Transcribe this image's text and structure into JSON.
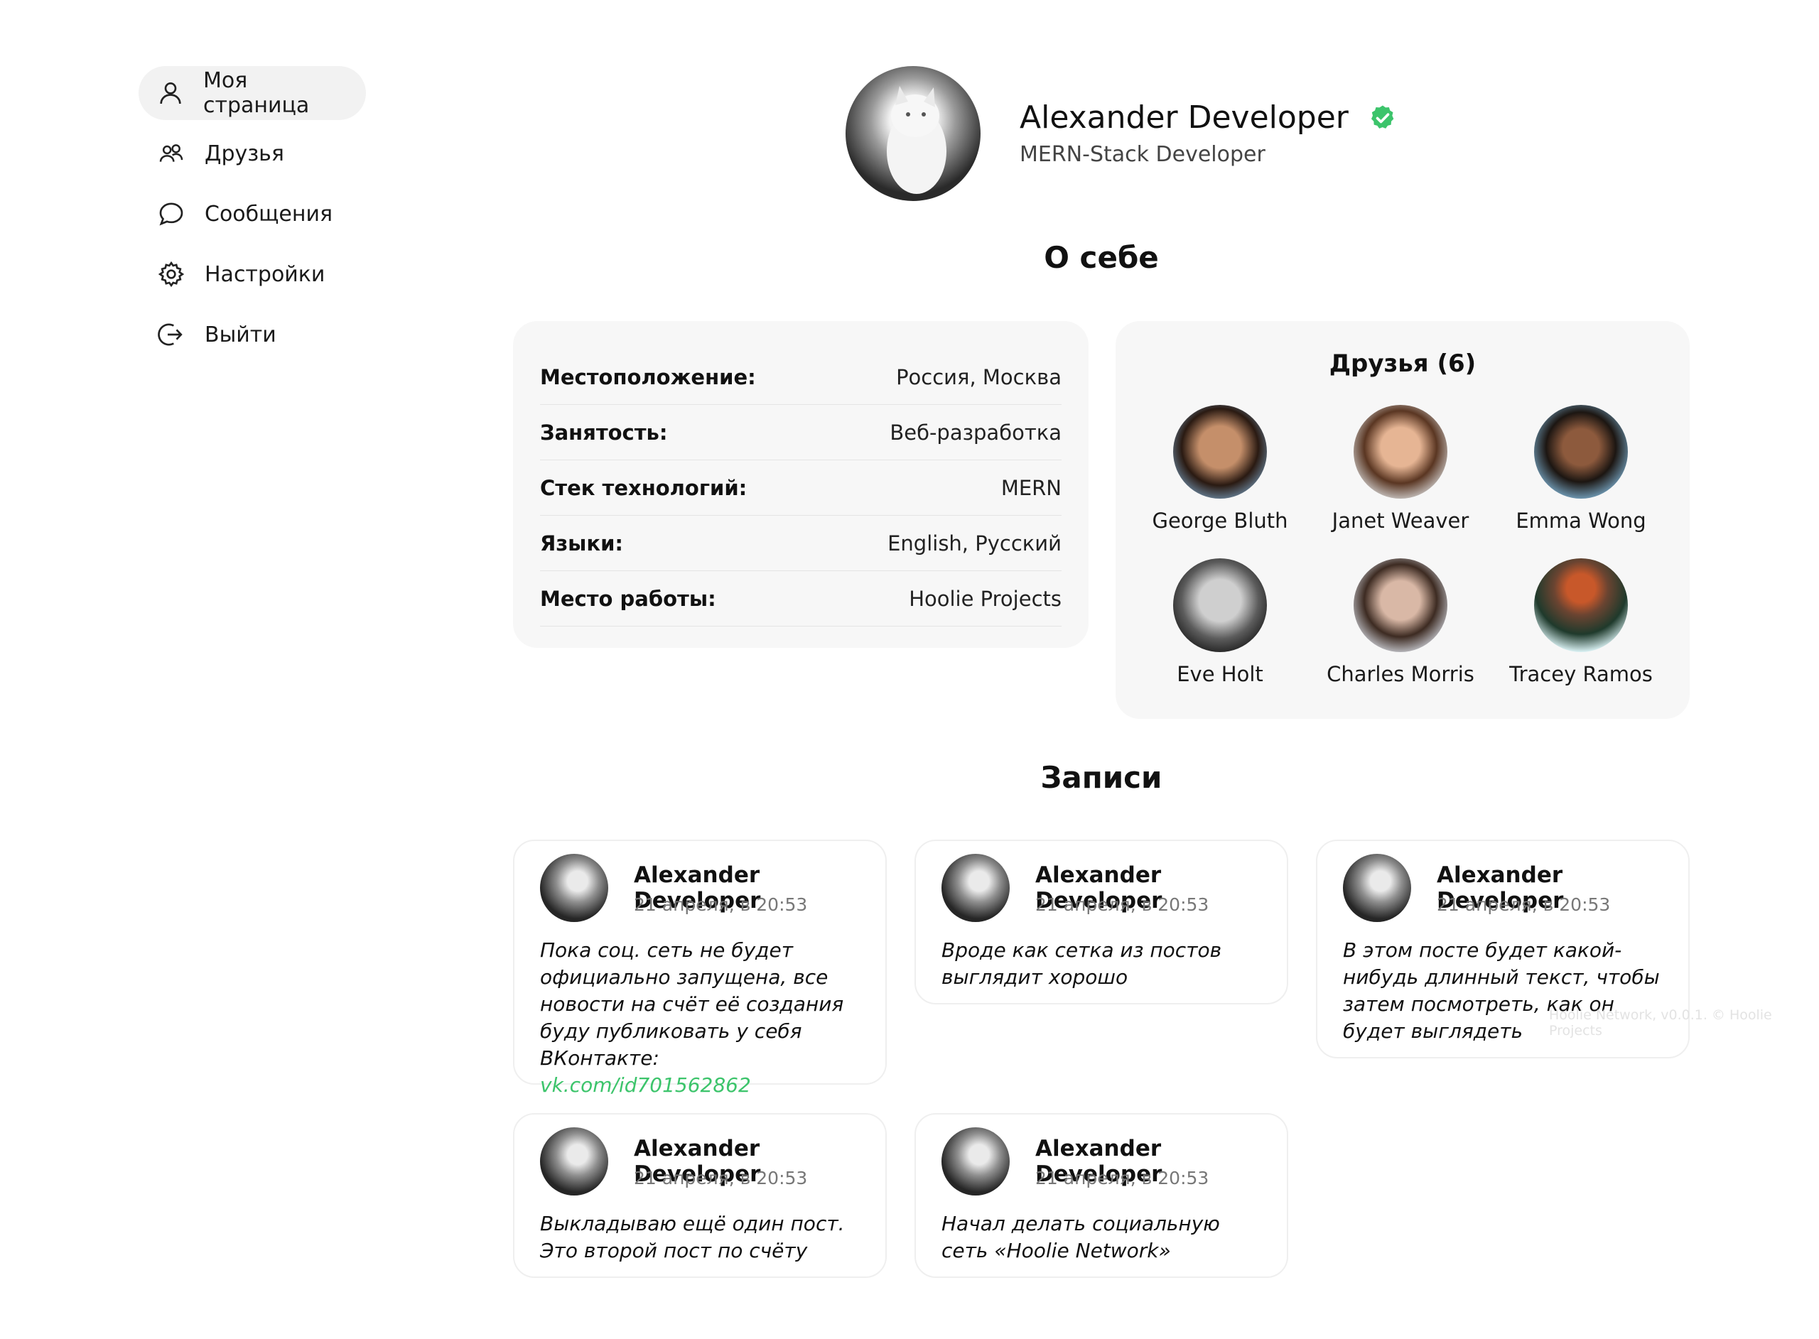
{
  "sidebar": {
    "items": [
      {
        "label": "Моя страница",
        "icon": "user-icon",
        "active": true
      },
      {
        "label": "Друзья",
        "icon": "friends-icon",
        "active": false
      },
      {
        "label": "Сообщения",
        "icon": "message-icon",
        "active": false
      },
      {
        "label": "Настройки",
        "icon": "gear-icon",
        "active": false
      },
      {
        "label": "Выйти",
        "icon": "logout-icon",
        "active": false
      }
    ]
  },
  "profile": {
    "name": "Alexander Developer",
    "role": "MERN-Stack Developer",
    "verified": true,
    "verified_color": "#3cc46b"
  },
  "about": {
    "title": "О себе",
    "rows": [
      {
        "key": "Местоположение:",
        "value": "Россия, Москва"
      },
      {
        "key": "Занятость:",
        "value": "Веб-разработка"
      },
      {
        "key": "Стек технологий:",
        "value": "MERN"
      },
      {
        "key": "Языки:",
        "value": "English, Русский"
      },
      {
        "key": "Место работы:",
        "value": "Hoolie Projects"
      }
    ]
  },
  "friends": {
    "title": "Друзья (6)",
    "items": [
      {
        "name": "George Bluth"
      },
      {
        "name": "Janet Weaver"
      },
      {
        "name": "Emma Wong"
      },
      {
        "name": "Eve Holt"
      },
      {
        "name": "Charles Morris"
      },
      {
        "name": "Tracey Ramos"
      }
    ]
  },
  "posts": {
    "title": "Записи",
    "items": [
      {
        "author": "Alexander Developer",
        "date": "21 апреля, в 20:53",
        "text": "Пока соц. сеть не будет официально запущена, все новости на счёт её создания буду публиковать у себя ВКонтакте:",
        "link": "vk.com/id701562862"
      },
      {
        "author": "Alexander Developer",
        "date": "21 апреля, в 20:53",
        "text": "Вроде как сетка из постов выглядит хорошо",
        "link": ""
      },
      {
        "author": "Alexander Developer",
        "date": "21 апреля, в 20:53",
        "text": "В этом посте будет какой-нибудь длинный текст, чтобы затем посмотреть, как он будет выглядеть",
        "link": ""
      },
      {
        "author": "Alexander Developer",
        "date": "21 апреля, в 20:53",
        "text": "Выкладываю ещё один пост. Это второй пост по счёту",
        "link": ""
      },
      {
        "author": "Alexander Developer",
        "date": "21 апреля, в 20:53",
        "text": "Начал делать социальную сеть «Hoolie Network»",
        "link": ""
      }
    ]
  },
  "footer": {
    "note": "Hoolie Network, v0.0.1. © Hoolie Projects"
  },
  "colors": {
    "accent": "#3cc46b",
    "card_bg": "#f7f7f7",
    "active_nav_bg": "#f2f2f2"
  }
}
